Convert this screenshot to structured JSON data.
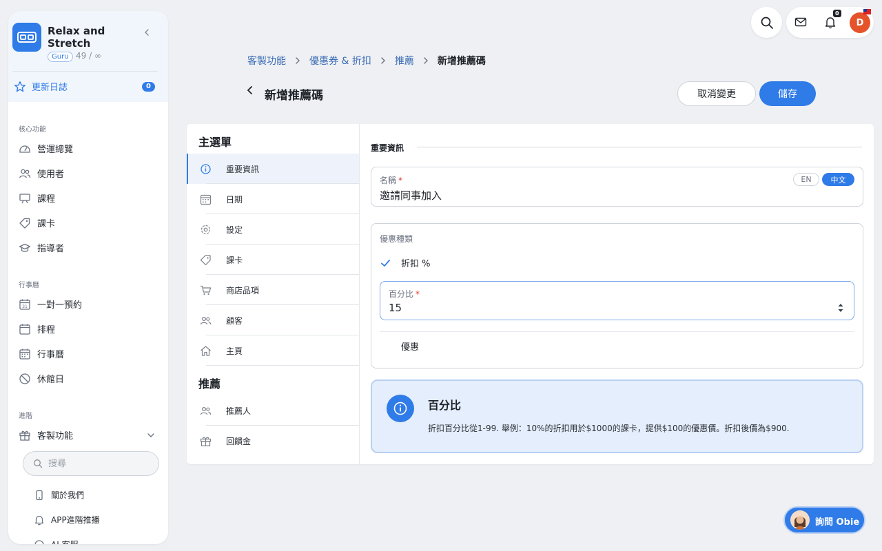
{
  "sidebar": {
    "org_name": "Relax and Stretch",
    "plan_badge": "Guru",
    "seat_count": "49 / ∞",
    "changelog": {
      "label": "更新日誌",
      "count": "0"
    },
    "sections": {
      "core": "核心功能",
      "calendar": "行事曆",
      "advanced": "進階"
    },
    "core_items": [
      {
        "label": "營運總覽",
        "icon": "dashboard-icon"
      },
      {
        "label": "使用者",
        "icon": "users-icon"
      },
      {
        "label": "課程",
        "icon": "presentation-icon"
      },
      {
        "label": "課卡",
        "icon": "tag-icon"
      },
      {
        "label": "指導者",
        "icon": "graduation-cap-icon"
      }
    ],
    "calendar_items": [
      {
        "label": "一對一預約",
        "icon": "calendar-31-icon"
      },
      {
        "label": "排程",
        "icon": "calendar-icon"
      },
      {
        "label": "行事曆",
        "icon": "calendar-grid-icon"
      },
      {
        "label": "休館日",
        "icon": "ban-icon"
      }
    ],
    "advanced_items": [
      {
        "label": "客製功能",
        "icon": "gift-icon"
      }
    ],
    "search_placeholder": "搜尋",
    "sub_items": [
      {
        "label": "關於我們",
        "icon": "mobile-icon"
      },
      {
        "label": "APP進階推播",
        "icon": "bell-icon"
      },
      {
        "label": "AI 客服",
        "icon": "chat-icon"
      }
    ]
  },
  "topbar": {
    "notification_count": "0",
    "avatar_initial": "D"
  },
  "breadcrumb": [
    "客製功能",
    "優惠券 & 折扣",
    "推薦",
    "新增推薦碼"
  ],
  "page": {
    "title": "新增推薦碼",
    "cancel_label": "取消變更",
    "save_label": "儲存"
  },
  "form_nav": {
    "main_heading": "主選單",
    "main_items": [
      {
        "label": "重要資訊",
        "icon": "info-icon",
        "active": true
      },
      {
        "label": "日期",
        "icon": "calendar-icon"
      },
      {
        "label": "設定",
        "icon": "gear-icon"
      },
      {
        "label": "課卡",
        "icon": "tag-icon"
      },
      {
        "label": "商店品項",
        "icon": "cart-icon"
      },
      {
        "label": "顧客",
        "icon": "users-icon"
      },
      {
        "label": "主頁",
        "icon": "home-icon"
      }
    ],
    "referral_heading": "推薦",
    "referral_items": [
      {
        "label": "推薦人",
        "icon": "users-icon"
      },
      {
        "label": "回饋金",
        "icon": "gift-icon"
      }
    ]
  },
  "form": {
    "section_title": "重要資訊",
    "name": {
      "label": "名稱",
      "required_mark": "*",
      "value": "邀請同事加入",
      "lang_en": "EN",
      "lang_zh": "中文"
    },
    "discount_type": {
      "label": "優惠種類",
      "selected_option": "折扣 %",
      "percent": {
        "label": "百分比",
        "required_mark": "*",
        "value": "15"
      },
      "other_option": "優惠"
    },
    "info": {
      "title": "百分比",
      "text": "折扣百分比從1-99. 舉例：10%的折扣用於$1000的課卡，提供$100的優惠價。折扣後價為$900."
    }
  },
  "chat": {
    "label": "詢問 Obie"
  },
  "colors": {
    "accent": "#2f7be8",
    "avatar": "#e4532a",
    "background": "#eef0f3"
  }
}
